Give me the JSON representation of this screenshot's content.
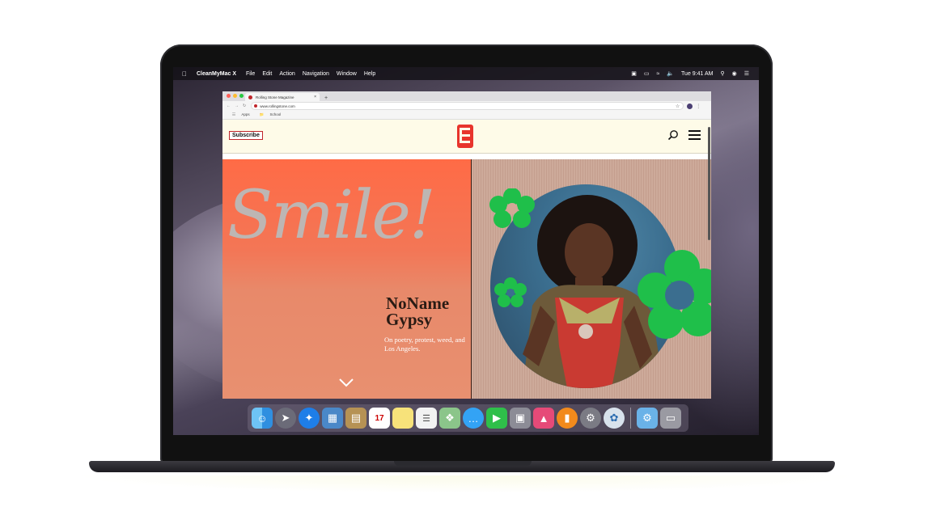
{
  "menubar": {
    "app_name": "CleanMyMac X",
    "items": [
      "File",
      "Edit",
      "Action",
      "Navigation",
      "Window",
      "Help"
    ],
    "clock": "Tue 9:41 AM"
  },
  "browser": {
    "tab_title": "Rolling Stone Magazine",
    "tab_close": "×",
    "new_tab": "+",
    "url": "www.rollingstone.com",
    "bookmarks": [
      "Apps",
      "School"
    ]
  },
  "site": {
    "subscribe_label": "Subscribe",
    "hero_title": "Smile!",
    "artist_line1": "NoName",
    "artist_line2": "Gypsy",
    "tagline": "On poetry, protest, weed, and Los Angeles."
  },
  "colors": {
    "hero_orange": "#ff6b46",
    "brand_red": "#c0262b",
    "flower_green": "#1fbf4a",
    "header_cream": "#fefbe8"
  },
  "dock": {
    "items": [
      "finder-icon",
      "launchpad-icon",
      "safari-icon",
      "preview-icon",
      "notes-icon",
      "calendar-icon",
      "stickies-icon",
      "reminders-icon",
      "maps-icon",
      "messages-icon",
      "facetime-icon",
      "photo-booth-icon",
      "keynote-icon",
      "books-icon",
      "system-preferences-icon",
      "cleanmymac-icon",
      "downloads-folder-icon",
      "trash-icon"
    ],
    "calendar_day": "17"
  }
}
